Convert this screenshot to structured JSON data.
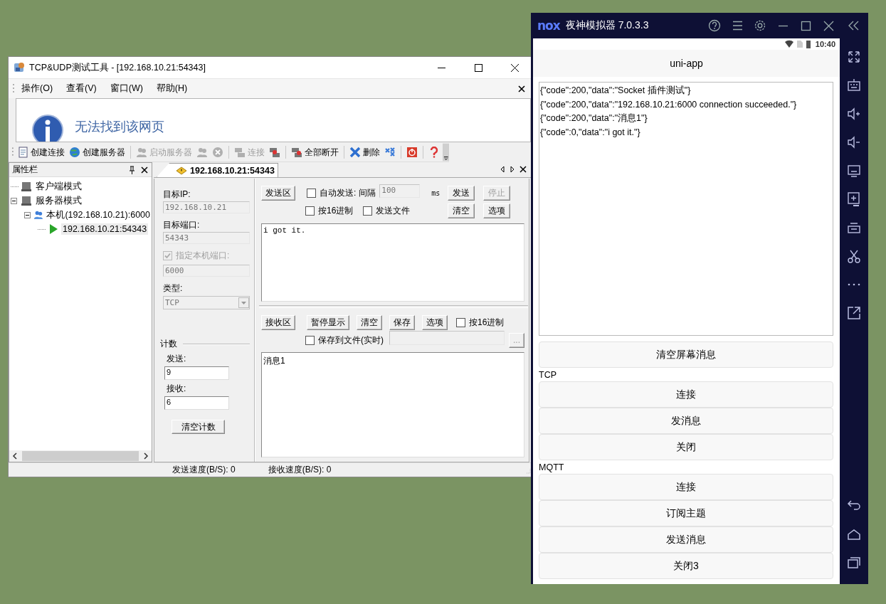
{
  "tcp_window": {
    "title": "TCP&UDP测试工具 - [192.168.10.21:54343]",
    "menu": [
      {
        "label": "操作(O)"
      },
      {
        "label": "查看(V)"
      },
      {
        "label": "窗口(W)"
      },
      {
        "label": "帮助(H)"
      }
    ],
    "browser_message": "无法找到该网页",
    "toolbar": [
      {
        "kind": "button",
        "label": "创建连接",
        "disabled": false
      },
      {
        "kind": "button",
        "label": "创建服务器",
        "disabled": false
      },
      {
        "kind": "separator"
      },
      {
        "kind": "button",
        "label": "启动服务器",
        "disabled": true
      },
      {
        "kind": "button",
        "disabled": true
      },
      {
        "kind": "button",
        "disabled": true
      },
      {
        "kind": "separator"
      },
      {
        "kind": "button",
        "label": "连接",
        "disabled": true
      },
      {
        "kind": "button",
        "disabled": false
      },
      {
        "kind": "separator"
      },
      {
        "kind": "button",
        "label": "全部断开",
        "disabled": false
      },
      {
        "kind": "separator"
      },
      {
        "kind": "button",
        "label": "删除",
        "disabled": false
      },
      {
        "kind": "button",
        "disabled": false
      },
      {
        "kind": "separator"
      },
      {
        "kind": "button",
        "disabled": false
      },
      {
        "kind": "separator"
      },
      {
        "kind": "button",
        "disabled": false
      }
    ],
    "panel": {
      "title": "属性栏",
      "tree": [
        {
          "label": "客户端模式",
          "selected": false
        },
        {
          "label": "服务器模式",
          "selected": false,
          "expanded": true,
          "children": [
            {
              "label": "本机(192.168.10.21):6000",
              "selected": false,
              "expanded": true,
              "children": [
                {
                  "label": "192.168.10.21:54343",
                  "selected": true
                }
              ]
            }
          ]
        }
      ]
    },
    "tab": "192.168.10.21:54343",
    "form": {
      "target_ip_label": "目标IP:",
      "target_ip": "192.168.10.21",
      "target_port_label": "目标端口:",
      "target_port": "54343",
      "local_port": {
        "label": "指定本机端口:",
        "checked": true,
        "disabled": true
      },
      "local_port_value": "6000",
      "type_label": "类型:",
      "type_value": "TCP"
    },
    "count": {
      "title": "计数",
      "sent_label": "发送:",
      "sent": "9",
      "received_label": "接收:",
      "received": "6",
      "clear_button": "清空计数"
    },
    "send_area": {
      "label": "发送区",
      "auto_send": {
        "label": "自动发送:",
        "checked": false
      },
      "interval_label": "间隔",
      "interval": "100",
      "unit": "ms",
      "send_button": {
        "label": "发送",
        "disabled": false
      },
      "stop_button": {
        "label": "停止",
        "disabled": true
      },
      "hex": {
        "label": "按16进制",
        "checked": false
      },
      "send_file": {
        "label": "发送文件",
        "checked": false
      },
      "clear_button": "清空",
      "options_button": "选项",
      "text": "i got it."
    },
    "receive_area": {
      "label": "接收区",
      "buttons": [
        "暂停显示",
        "清空",
        "保存",
        "选项"
      ],
      "hex": {
        "label": "按16进制",
        "checked": false
      },
      "save_to_file": {
        "label": "保存到文件(实时)",
        "checked": false
      },
      "browse_button": "...",
      "text": "消息1"
    },
    "status_bar": [
      "发送速度(B/S): 0",
      "接收速度(B/S): 0"
    ]
  },
  "emulator": {
    "logo": "nox",
    "title": "夜神模拟器 7.0.3.3",
    "time": "10:40",
    "app_title": "uni-app",
    "log": [
      "{\"code\":200,\"data\":\"Socket 插件测试\"}",
      "{\"code\":200,\"data\":\"192.168.10.21:6000 connection succeeded.\"}",
      "{\"code\":200,\"data\":\"消息1\"}",
      "{\"code\":0,\"data\":\"i got it.\"}"
    ],
    "clear_button": "清空屏幕消息",
    "sections": [
      {
        "heading": "TCP",
        "buttons": [
          "连接",
          "发消息",
          "关闭"
        ]
      },
      {
        "heading": "MQTT",
        "buttons": [
          "连接",
          "订阅主题",
          "发送消息",
          "关闭3"
        ]
      }
    ]
  }
}
